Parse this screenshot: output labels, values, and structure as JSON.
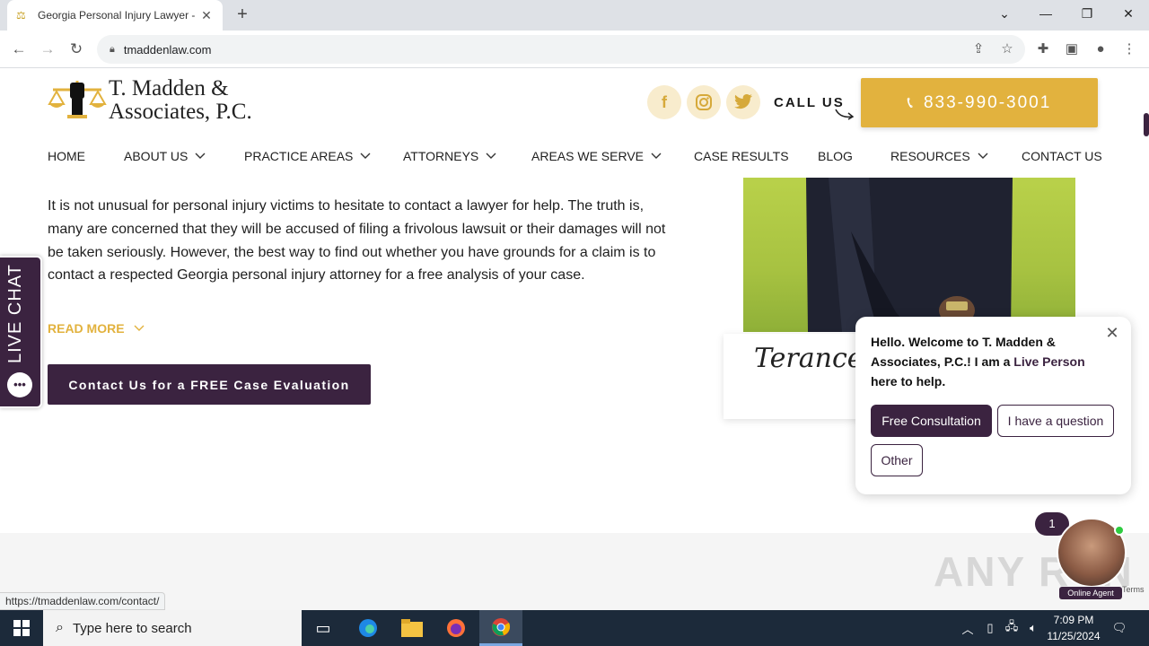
{
  "browser": {
    "tab_title": "Georgia Personal Injury Lawyer -",
    "url": "tmaddenlaw.com",
    "status_url": "https://tmaddenlaw.com/contact/"
  },
  "site": {
    "logo_line1": "T. Madden &",
    "logo_line2": "Associates, P.C.",
    "call_us": "CALL US",
    "phone": "833-990-3001",
    "nav": [
      {
        "label": "HOME",
        "has_dropdown": false
      },
      {
        "label": "ABOUT US",
        "has_dropdown": true
      },
      {
        "label": "PRACTICE AREAS",
        "has_dropdown": true
      },
      {
        "label": "ATTORNEYS",
        "has_dropdown": true
      },
      {
        "label": "AREAS WE SERVE",
        "has_dropdown": true
      },
      {
        "label": "CASE RESULTS",
        "has_dropdown": false
      },
      {
        "label": "BLOG",
        "has_dropdown": false
      },
      {
        "label": "RESOURCES",
        "has_dropdown": true
      },
      {
        "label": "CONTACT US",
        "has_dropdown": false
      }
    ],
    "body_text": "It is not unusual for personal injury victims to hesitate to contact a lawyer for help. The truth is, many are concerned that they will be accused of filing a frivolous lawsuit or their damages will not be taken seriously. However, the best way to find out whether you have grounds for a claim is to contact a respected Georgia personal injury attorney for a free analysis of your case.",
    "read_more": "READ MORE",
    "cta": "Contact Us for a FREE Case Evaluation",
    "signature": "Terance",
    "live_chat": "LIVE CHAT"
  },
  "chat": {
    "msg_part1": "Hello. Welcome to T. Madden & Associates, P.C.! I am a ",
    "msg_highlight": "Live Person",
    "msg_part2": " here to help.",
    "options": [
      "Free Consultation",
      "I have a question",
      "Other"
    ],
    "badge_count": "1",
    "agent_label": "Online Agent"
  },
  "watermark": "ANY RUN",
  "terms": "Terms",
  "taskbar": {
    "search_placeholder": "Type here to search",
    "time": "7:09 PM",
    "date": "11/25/2024"
  },
  "colors": {
    "brand_gold": "#e2b23e",
    "brand_purple": "#3b2340"
  }
}
